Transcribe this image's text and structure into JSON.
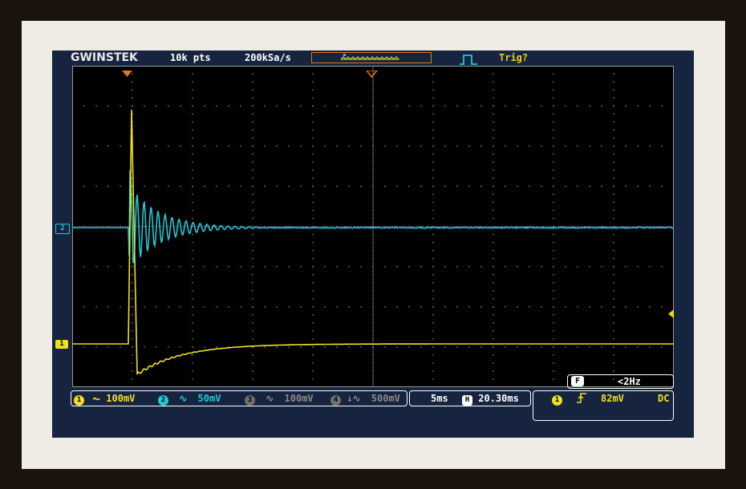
{
  "header": {
    "brand": "GWINSTEK",
    "record_length": "10k pts",
    "sample_rate": "200kSa/s",
    "trigger_status": "Trig?"
  },
  "channels": [
    {
      "id": "1",
      "label": "1",
      "scale": "100mV",
      "coupling_icon": "dc-coupling-icon",
      "color": "#f0e020"
    },
    {
      "id": "2",
      "label": "2",
      "scale": "50mV",
      "coupling_icon": "ac-coupling-icon",
      "color": "#20c8d8"
    },
    {
      "id": "3",
      "label": "3",
      "scale": "100mV",
      "coupling_icon": "ac-coupling-icon",
      "color": "#8a8a8a"
    },
    {
      "id": "4",
      "label": "4",
      "scale": "500mV",
      "coupling_icon": "ac-coupling-icon",
      "color": "#8a8a8a"
    }
  ],
  "timebase": {
    "scale": "5ms",
    "position_label": "H",
    "position": "20.30ms"
  },
  "trigger": {
    "source": "1",
    "slope_icon": "rising-edge-icon",
    "level": "82mV",
    "coupling": "DC"
  },
  "frequency": {
    "label": "F",
    "value": "<2Hz"
  },
  "colors": {
    "ch1": "#f0e020",
    "ch2": "#20c8d8",
    "accent": "#e07818",
    "background": "#000000",
    "bezel": "#16243f"
  }
}
